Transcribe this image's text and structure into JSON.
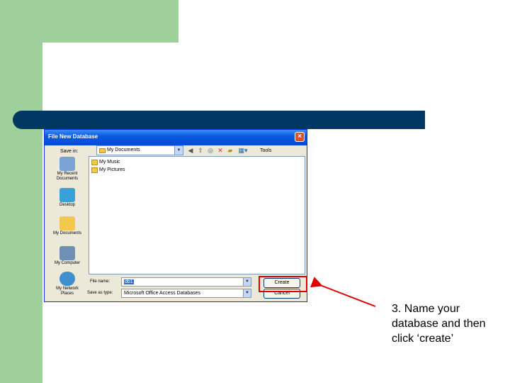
{
  "dialog": {
    "title": "File New Database",
    "save_in_label": "Save in:",
    "save_in_value": "My Documents",
    "tools_label": "Tools",
    "places": [
      {
        "label": "My Recent Documents",
        "icon": "recent-documents-icon",
        "color": "#7aa2d6"
      },
      {
        "label": "Desktop",
        "icon": "desktop-icon",
        "color": "#3aa0d8"
      },
      {
        "label": "My Documents",
        "icon": "my-documents-icon",
        "color": "#f2c94c"
      },
      {
        "label": "My Computer",
        "icon": "my-computer-icon",
        "color": "#6f8fb5"
      },
      {
        "label": "My Network Places",
        "icon": "network-places-icon",
        "color": "#3f8fcf"
      }
    ],
    "files": [
      "My Music",
      "My Pictures"
    ],
    "file_name_label": "File name:",
    "file_name_value": "db1",
    "save_type_label": "Save as type:",
    "save_type_value": "Microsoft Office Access Databases",
    "create_label": "Create",
    "cancel_label": "Cancel"
  },
  "caption": "3. Name your database and then click ‘create’",
  "colors": {
    "green": "#9fcf9b",
    "bar": "#003863",
    "highlight": "#e00000"
  }
}
